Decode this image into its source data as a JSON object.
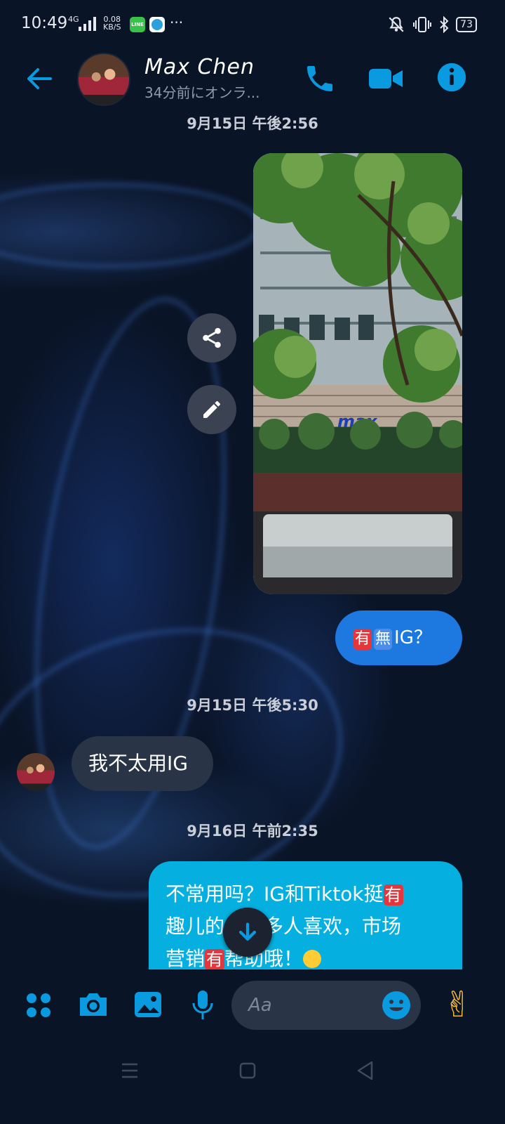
{
  "status_bar": {
    "time": "10:49",
    "network_type": "4G",
    "speed_value": "0.08",
    "speed_unit": "KB/S",
    "notif_more": "···",
    "battery": "73"
  },
  "header": {
    "contact_name": "Max Chen",
    "contact_status": "34分前にオンラ..."
  },
  "messages": {
    "stamp1": "9月15日 午後2:56",
    "photo_sign": "max",
    "question_text": "IG？",
    "emoji_you": "有",
    "emoji_nothing": "無",
    "stamp2": "9月15日 午後5:30",
    "reply_in": "我不太用IG",
    "stamp3": "9月16日 午前2:35",
    "long_line1": "不常用吗？IG和Tiktok挺",
    "long_line1_emoji": "有",
    "long_line2": "趣儿的，很多人喜欢，市场",
    "long_line3_a": "营销",
    "long_line3_emoji": "有",
    "long_line3_b": "帮助哦！"
  },
  "composer": {
    "placeholder": "Aa",
    "thumbs_emoji": "✌"
  },
  "colors": {
    "accent": "#0a9ae0",
    "outgoing_bubble": "#1d78e0",
    "outgoing_bubble_2": "#05b0e0",
    "incoming_bubble": "#2a3447",
    "background": "#0a1427"
  }
}
